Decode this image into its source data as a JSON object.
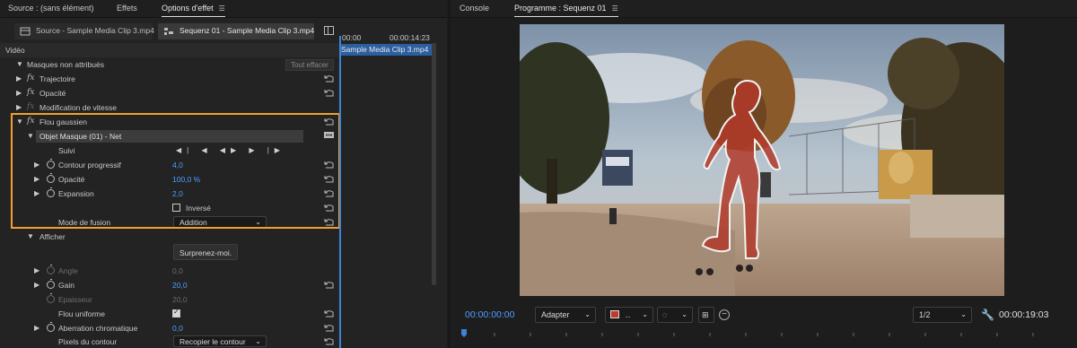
{
  "left_tabs": {
    "source": "Source : (sans élément)",
    "effects": "Effets",
    "effect_options": "Options d'effet",
    "menu_glyph": "☰"
  },
  "clip_buttons": {
    "source_clip": "Source - Sample Media Clip 3.mp4",
    "sequence_clip": "Sequenz 01 - Sample Media Clip 3.mp4"
  },
  "timeline": {
    "start_tc": "00:00",
    "end_tc": "00:00:14:23",
    "clip_label": "Sample Media Clip 3.mp4"
  },
  "effects_panel": {
    "video_header": "Vidéo",
    "unassigned_masks": "Masques non attribués",
    "clear_all": "Tout effacer",
    "motion": "Trajectoire",
    "opacity": "Opacité",
    "time_remap": "Modification de vitesse",
    "gaussian_blur": "Flou gaussien",
    "mask_object": "Objet Masque (01) - Net",
    "tracking": "Suivi",
    "tracking_buttons": "◀| ◀ ◀▶ ▶ |▶",
    "feather_label": "Contour progressif",
    "feather_value": "4,0",
    "mask_opacity_label": "Opacité",
    "mask_opacity_value": "100,0 %",
    "expansion_label": "Expansion",
    "expansion_value": "2,0",
    "inverted_label": "Inversé",
    "blend_mode_label": "Mode de fusion",
    "blend_mode_value": "Addition",
    "show_label": "Afficher",
    "surprise_button": "Surprenez-moi.",
    "angle_label": "Angle",
    "angle_value": "0,0",
    "gain_label": "Gain",
    "gain_value": "20,0",
    "thickness_label": "Epaisseur",
    "thickness_value": "20,0",
    "uniform_blur_label": "Flou uniforme",
    "chromatic_label": "Aberration chromatique",
    "chromatic_value": "0,0",
    "edge_pixels_label": "Pixels du contour",
    "edge_pixels_value": "Recopier le contour"
  },
  "program_monitor": {
    "console_tab": "Console",
    "program_tab": "Programme : Sequenz 01",
    "current_tc": "00:00:00:00",
    "fit_value": "Adapter",
    "resolution_value": "1/2",
    "duration_tc": "00:00:19:03",
    "mask_color": "#c0392b"
  },
  "colors": {
    "accent_blue": "#4aa0ff",
    "highlight_orange": "#f0a030"
  }
}
